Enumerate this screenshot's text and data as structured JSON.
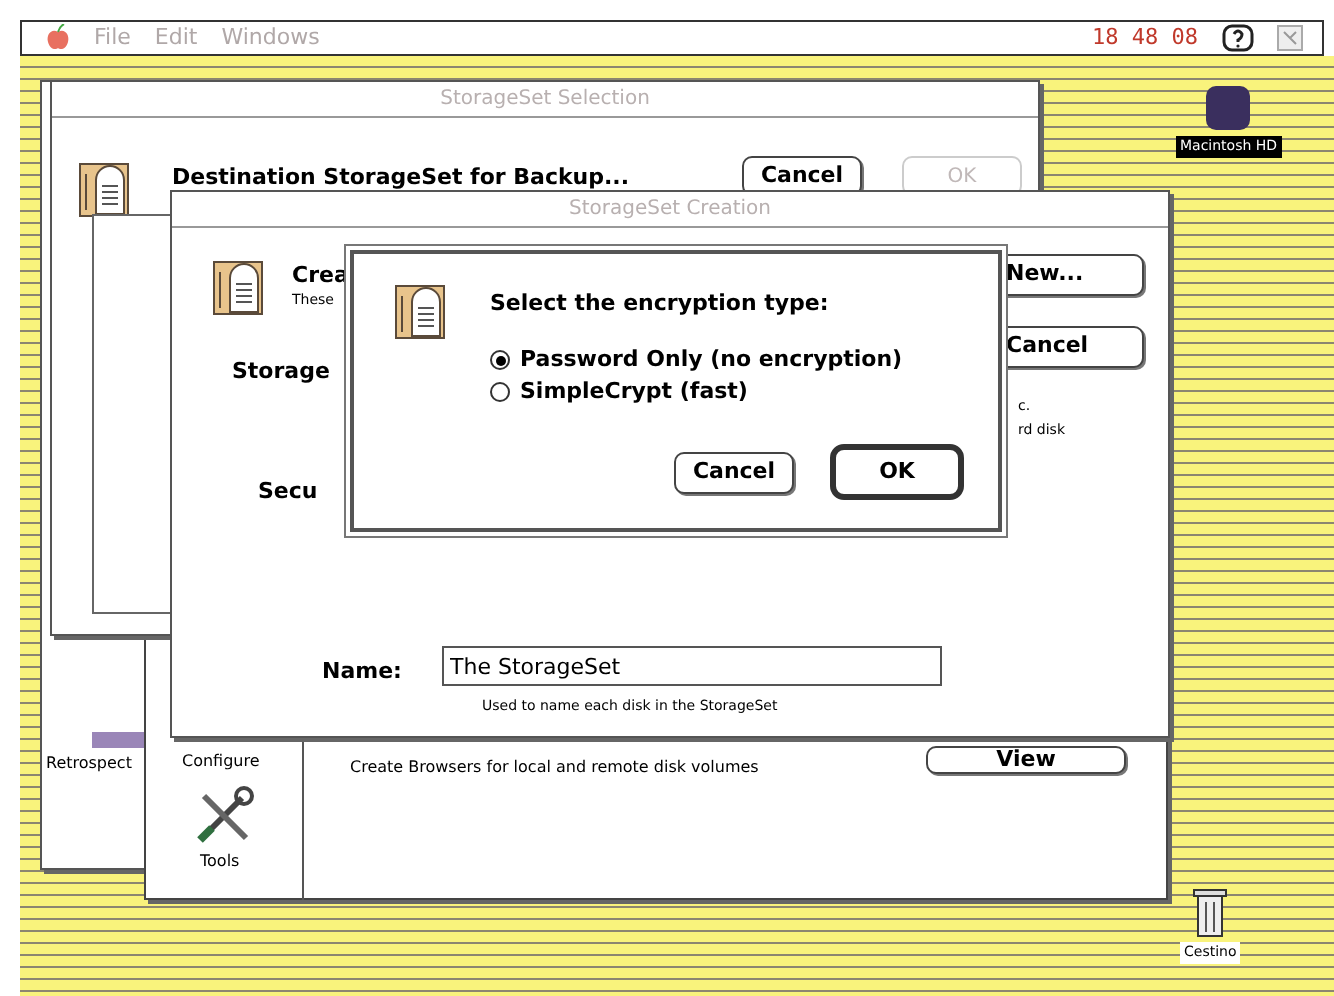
{
  "menu_bar": {
    "menus": [
      {
        "label": "File",
        "disabled": true
      },
      {
        "label": "Edit",
        "disabled": true
      },
      {
        "label": "Windows",
        "disabled": true
      }
    ],
    "clock": "18 48 08"
  },
  "desktop_icons": [
    {
      "kind": "disk",
      "label": "Macintosh HD"
    },
    {
      "kind": "trash",
      "label": "Cestino"
    }
  ],
  "retrospect_window": {
    "label": "Retrospect"
  },
  "tools_window": {
    "sidebar": [
      {
        "kind": "configure",
        "label": "Configure"
      },
      {
        "kind": "tools",
        "label": "Tools"
      }
    ],
    "description": "Create Browsers for local and remote disk volumes",
    "button": "View"
  },
  "selection_window": {
    "title": "StorageSet Selection",
    "heading": "Destination StorageSet for Backup...",
    "buttons": [
      {
        "label": "Cancel",
        "disabled": false
      },
      {
        "label": "OK",
        "disabled": true
      }
    ]
  },
  "creation_window": {
    "title": "StorageSet Creation",
    "heading": "Crea",
    "subtext": "These",
    "labels": [
      "Storage",
      "Secu"
    ],
    "buttons": [
      "New...",
      "Cancel"
    ],
    "notes": [
      "c.",
      "rd disk"
    ],
    "name_label": "Name:",
    "name_value": "The StorageSet",
    "name_hint": "Used to name each disk in the StorageSet"
  },
  "dialog": {
    "prompt": "Select the encryption type:",
    "options": [
      {
        "label": "Password Only (no encryption)",
        "selected": true
      },
      {
        "label": "SimpleCrypt (fast)",
        "selected": false
      }
    ],
    "buttons": [
      {
        "label": "Cancel",
        "default": false
      },
      {
        "label": "OK",
        "default": true
      }
    ]
  }
}
